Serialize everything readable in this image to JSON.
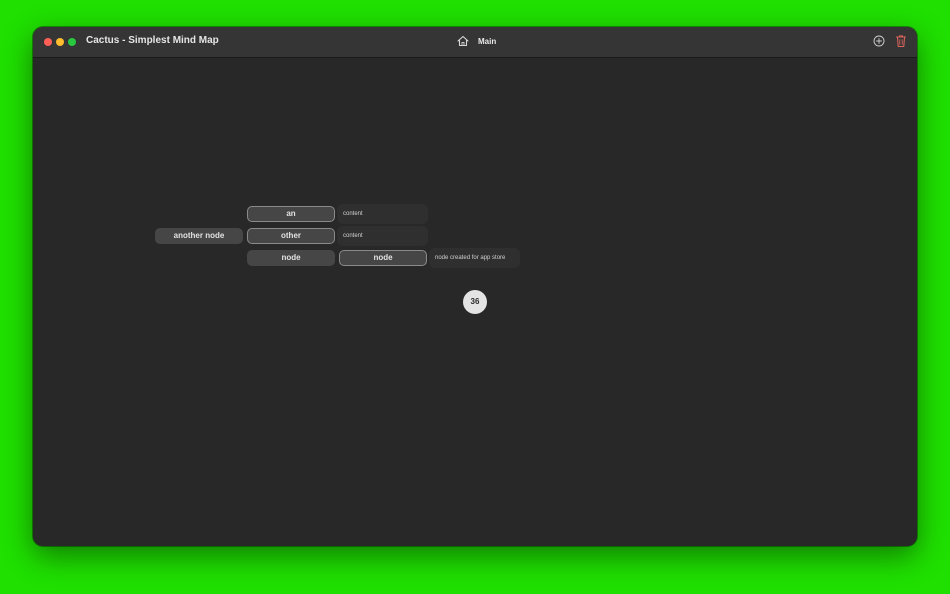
{
  "window": {
    "title": "Cactus - Simplest Mind Map"
  },
  "toolbar": {
    "home_icon": "home-icon",
    "breadcrumb": "Main",
    "add_icon": "plus-circle-icon",
    "delete_icon": "trash-icon",
    "delete_color": "#e0665c"
  },
  "mindmap": {
    "root": "another node",
    "children": [
      {
        "label": "an",
        "content": "content"
      },
      {
        "label": "other",
        "content": "content"
      },
      {
        "label": "node",
        "child": {
          "label": "node",
          "content": "node created for app store"
        }
      }
    ]
  },
  "counter": "36"
}
